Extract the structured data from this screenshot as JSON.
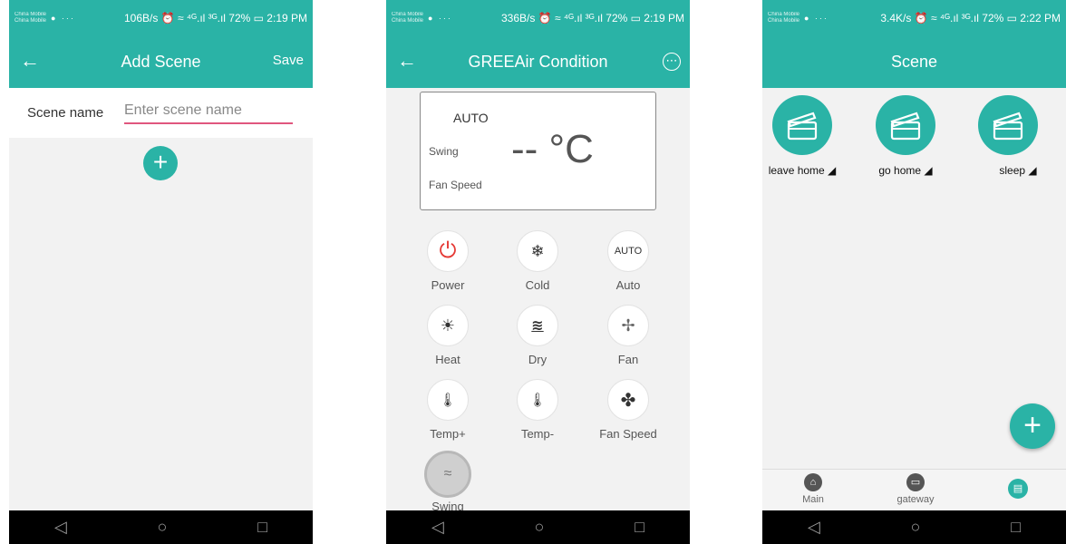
{
  "colors": {
    "accent": "#2ab3a6",
    "input_underline": "#e0567e",
    "power_red": "#e53935"
  },
  "screen1": {
    "status": {
      "carrier_a": "China Mobile",
      "carrier_b": "China Mobile",
      "dots": "● ···",
      "text": "106B/s ⏰ ≈ ⁴ᴳ.ıl ³ᴳ.ıl 72% ▭ 2:19 PM"
    },
    "title": "Add Scene",
    "back": "←",
    "save": "Save",
    "scene_name_label": "Scene name",
    "scene_name_placeholder": "Enter scene name",
    "add": "+"
  },
  "screen2": {
    "status": {
      "carrier_a": "China Mobile",
      "carrier_b": "China Mobile",
      "dots": "● ···",
      "text": "336B/s ⏰ ≈ ⁴ᴳ.ıl ³ᴳ.ıl 72% ▭ 2:19 PM"
    },
    "title": "GREEAir Condition",
    "back": "←",
    "more": "⋯",
    "display": {
      "mode": "AUTO",
      "swing": "Swing",
      "fan_speed": "Fan Speed",
      "temp": "-- °C"
    },
    "controls": [
      {
        "label": "Power",
        "icon": "⏻"
      },
      {
        "label": "Cold",
        "icon": "❄"
      },
      {
        "label": "Auto",
        "icon": "AUTO"
      },
      {
        "label": "Heat",
        "icon": "☀"
      },
      {
        "label": "Dry",
        "icon": "≋"
      },
      {
        "label": "Fan",
        "icon": "✢"
      },
      {
        "label": "Temp+",
        "icon": "🌡"
      },
      {
        "label": "Temp-",
        "icon": "🌡"
      },
      {
        "label": "Fan Speed",
        "icon": "✤"
      },
      {
        "label": "Swing",
        "icon": "≈"
      }
    ]
  },
  "screen3": {
    "status": {
      "carrier_a": "China Mobile",
      "carrier_b": "China Mobile",
      "dots": "● ···",
      "text": "3.4K/s ⏰ ≈ ⁴ᴳ.ıl ³ᴳ.ıl 72% ▭ 2:22 PM"
    },
    "title": "Scene",
    "scenes": [
      {
        "name": "leave home ◢"
      },
      {
        "name": "go home ◢"
      },
      {
        "name": "sleep ◢"
      }
    ],
    "add": "+",
    "tabs": [
      {
        "label": "Main",
        "icon": "⌂"
      },
      {
        "label": "gateway",
        "icon": "▭"
      },
      {
        "label": "",
        "icon": "▤"
      }
    ]
  },
  "nav": {
    "back": "◁",
    "home": "○",
    "recent": "□"
  }
}
